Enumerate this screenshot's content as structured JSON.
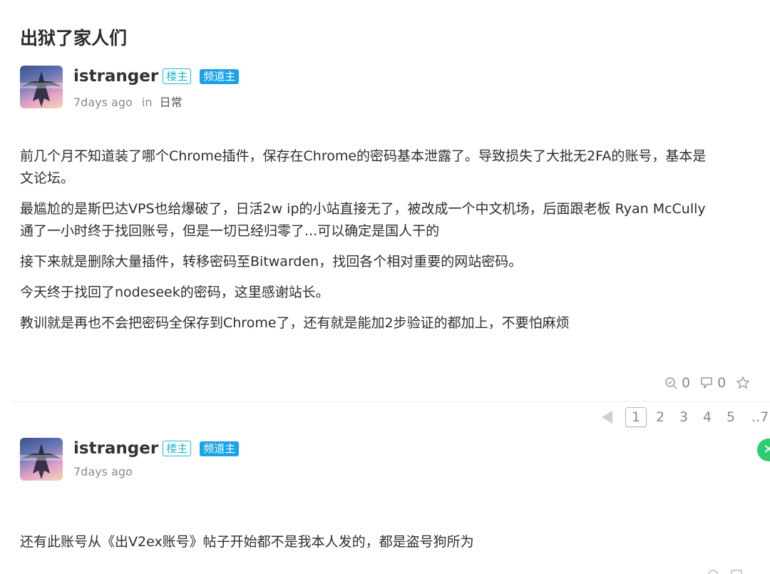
{
  "post": {
    "title": "出狱了家人们"
  },
  "colors": {
    "op_badge": "#1fb8c9",
    "channel_badge": "#1aa3e8",
    "float_button": "#2ecc71"
  },
  "posts": [
    {
      "author": "istranger",
      "badge_op": "楼主",
      "badge_channel": "频道主",
      "time": "7days ago",
      "in_label": "in",
      "category": "日常",
      "paragraphs": [
        "前几个月不知道装了哪个Chrome插件，保存在Chrome的密码基本泄露了。导致损失了大批无2FA的账号，基本是",
        "文论坛。",
        "最尴尬的是斯巴达VPS也给爆破了，日活2w ip的小站直接无了，被改成一个中文机场，后面跟老板 Ryan McCully",
        "通了一小时终于找回账号，但是一切已经归零了...可以确定是国人干的",
        "接下来就是删除大量插件，转移密码至Bitwarden，找回各个相对重要的网站密码。",
        "今天终于找回了nodeseek的密码，这里感谢站长。",
        "教训就是再也不会把密码全保存到Chrome了，还有就是能加2步验证的都加上，不要怕麻烦"
      ],
      "actions": {
        "like_icon": "like-icon",
        "like_count": "0",
        "dislike_icon": "dislike-icon",
        "dislike_count": "0",
        "star_icon": "star-icon"
      }
    },
    {
      "author": "istranger",
      "badge_op": "楼主",
      "badge_channel": "频道主",
      "time": "7days ago",
      "paragraphs": [
        "还有此账号从《出V2ex账号》帖子开始都不是我本人发的，都是盗号狗所为"
      ]
    }
  ],
  "pagination": {
    "prev_icon": "triangle-left-icon",
    "pages": [
      "1",
      "2",
      "3",
      "4",
      "5"
    ],
    "current": "1",
    "ellipsis": "..7"
  },
  "float_button_icon": "close-icon"
}
